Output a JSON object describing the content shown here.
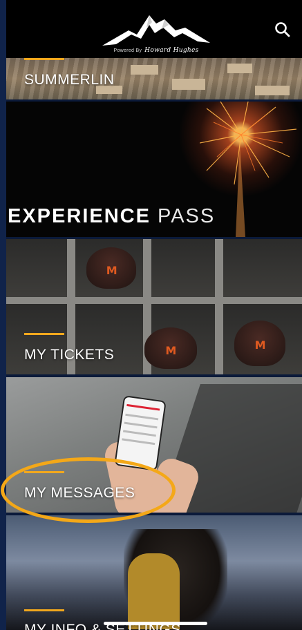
{
  "header": {
    "powered_by": "Powered By",
    "brand_signature": "Howard Hughes"
  },
  "cards": [
    {
      "label": "SUMMERLIN"
    },
    {
      "label_bold": "EXPERIENCE",
      "label_light": "PASS"
    },
    {
      "label": "MY TICKETS"
    },
    {
      "label": "MY MESSAGES"
    },
    {
      "label": "MY INFO & SETTINGS"
    }
  ],
  "colors": {
    "accent": "#f2a81d",
    "annotation": "#f4a818",
    "frame": "#10234a",
    "header_bg": "#000000"
  },
  "icons": {
    "search": "search-icon",
    "logo": "mountain-logo-icon"
  }
}
